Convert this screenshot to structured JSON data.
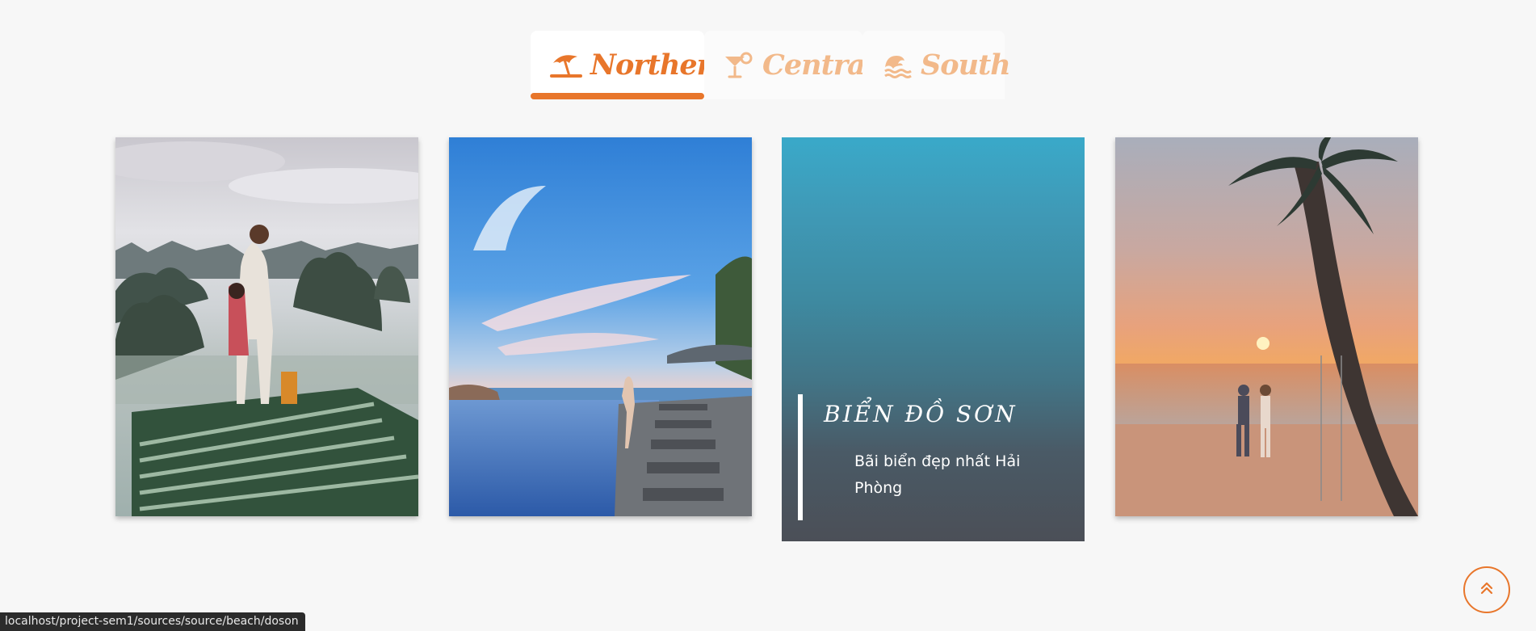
{
  "tabs": [
    {
      "label": "Northern",
      "icon": "beach-umbrella-icon",
      "active": true
    },
    {
      "label": "Central",
      "icon": "cocktail-icon",
      "active": false
    },
    {
      "label": "South",
      "icon": "water-wave-icon",
      "active": false
    }
  ],
  "cards": [
    {
      "image": "ha-long-bay-couple-photo"
    },
    {
      "image": "infinity-pool-photo"
    },
    {
      "title": "BIỂN ĐỒ SƠN",
      "description": "Bãi biển đẹp nhất Hải Phòng"
    },
    {
      "image": "sunset-palm-beach-photo"
    }
  ],
  "status_bar": {
    "url": "localhost/project-sem1/sources/source/beach/doson"
  },
  "scroll_top": {
    "icon": "double-chevron-up-icon"
  },
  "colors": {
    "accent": "#e8762b",
    "accent_light": "#f2b98a",
    "background": "#f7f7f7"
  }
}
